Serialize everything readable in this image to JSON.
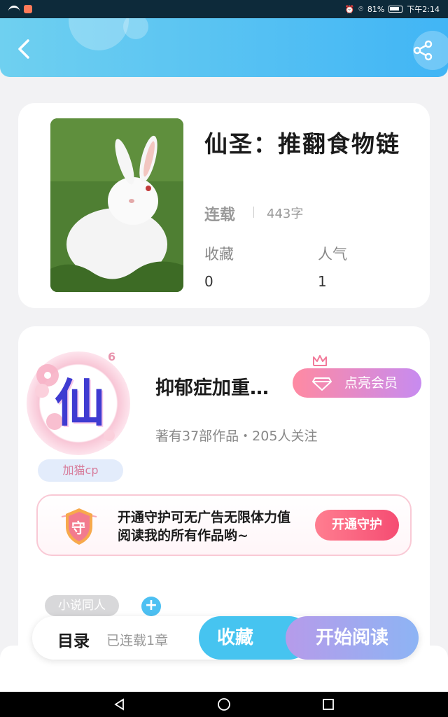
{
  "status_bar": {
    "battery_percent": "81%",
    "time": "下午2:14"
  },
  "book": {
    "title": "仙圣：推翻食物链",
    "status": "连载",
    "word_count": "443字",
    "favorites_label": "收藏",
    "favorites_value": "0",
    "popularity_label": "人气",
    "popularity_value": "1"
  },
  "author": {
    "avatar_glyph": "仙",
    "avatar_badge": "6",
    "tag": "加猫cp",
    "name": "抑郁症加重…",
    "vip_button": "点亮会员",
    "stats": "著有37部作品・205人关注"
  },
  "guard": {
    "shield_glyph": "守",
    "text": "开通守护可无广告无限体力值阅读我的所有作品哟~",
    "button": "开通守护"
  },
  "tags": {
    "chip": "小说同人",
    "add": "+"
  },
  "bottom_bar": {
    "toc": "目录",
    "serial_info": "已连载1章",
    "favorite": "收藏",
    "start_reading": "开始阅读"
  },
  "colors": {
    "header_start": "#6fd0f0",
    "header_end": "#41b5f5",
    "accent_blue": "#46c4f0",
    "guard_pink": "#f54c72",
    "vip_gradient_end": "#c78bf0"
  }
}
